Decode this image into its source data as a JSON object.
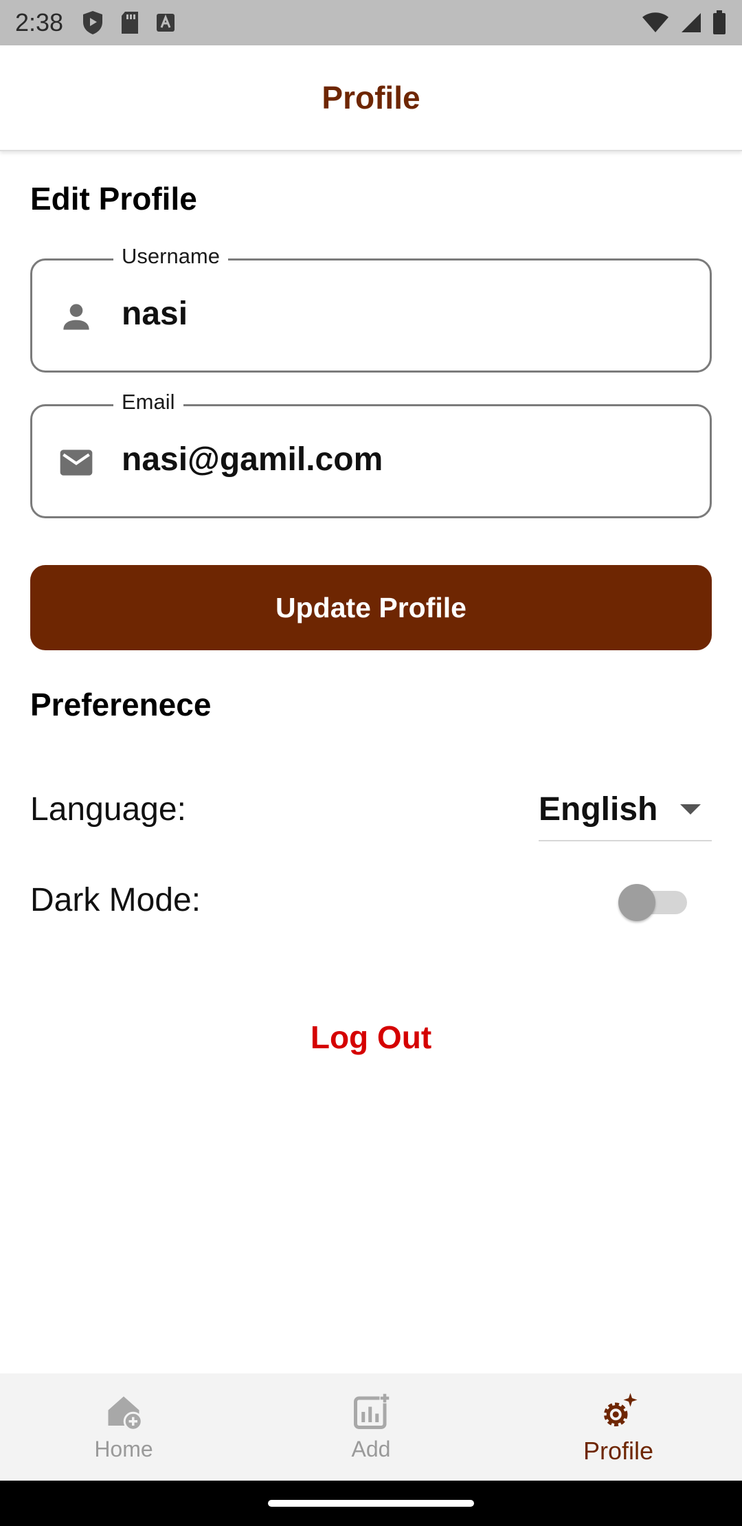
{
  "status_bar": {
    "time": "2:38",
    "left_icons": [
      "shield-play-icon",
      "sd-card-icon",
      "keyboard-a-icon"
    ],
    "right_icons": [
      "wifi-icon",
      "cell-signal-icon",
      "battery-icon"
    ]
  },
  "app_bar": {
    "title": "Profile"
  },
  "edit_profile": {
    "title": "Edit Profile",
    "username": {
      "label": "Username",
      "value": "nasi",
      "icon": "person-icon"
    },
    "email": {
      "label": "Email",
      "value": "nasi@gamil.com",
      "icon": "mail-icon"
    },
    "update_button": "Update Profile"
  },
  "preferences": {
    "title": "Preferenece",
    "language_label": "Language:",
    "language_value": "English",
    "dark_mode_label": "Dark Mode:",
    "dark_mode_on": false
  },
  "logout": "Log Out",
  "bottom_nav": {
    "items": [
      {
        "label": "Home",
        "icon": "home-add-icon",
        "active": false
      },
      {
        "label": "Add",
        "icon": "chart-add-icon",
        "active": false
      },
      {
        "label": "Profile",
        "icon": "settings-sparkle-icon",
        "active": true
      }
    ]
  },
  "colors": {
    "brand": "#6e2602",
    "danger": "#d50000",
    "inactive": "#9a9a9a"
  }
}
